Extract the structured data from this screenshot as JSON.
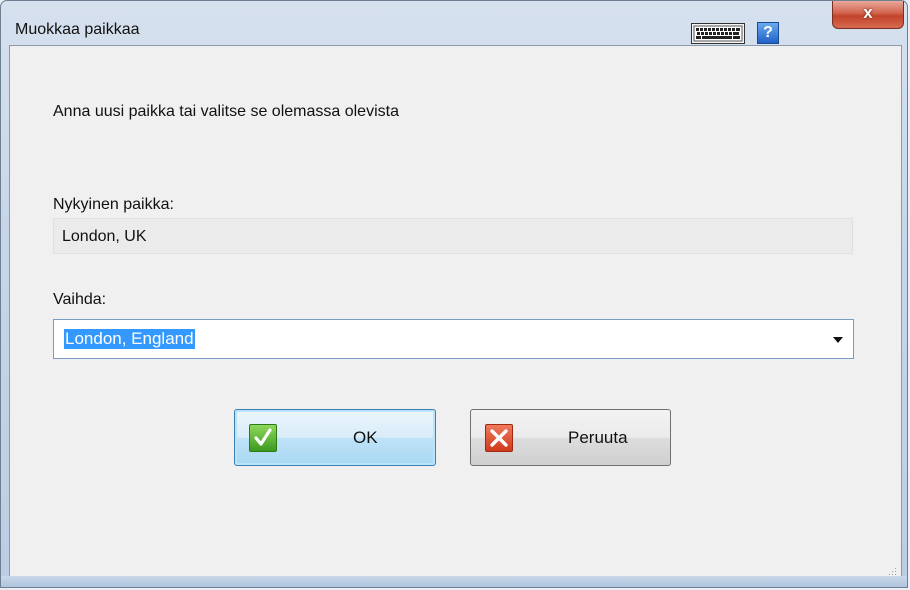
{
  "window": {
    "title": "Muokkaa paikkaa",
    "close_label": "x",
    "help_label": "?"
  },
  "dialog": {
    "instruction": "Anna uusi paikka tai valitse se olemassa olevista",
    "current_label": "Nykyinen paikka:",
    "current_value": "London, UK",
    "change_label": "Vaihda:",
    "change_value": "London, England"
  },
  "buttons": {
    "ok_label": "OK",
    "cancel_label": "Peruuta"
  },
  "icons": {
    "keyboard": "keyboard-icon",
    "help": "help-icon",
    "close": "close-icon",
    "ok": "checkmark-icon",
    "cancel": "x-icon",
    "dropdown": "chevron-down-icon"
  },
  "colors": {
    "selection": "#3399ff",
    "ok_button_border": "#3c7fb1",
    "close_button": "#c2432a"
  }
}
